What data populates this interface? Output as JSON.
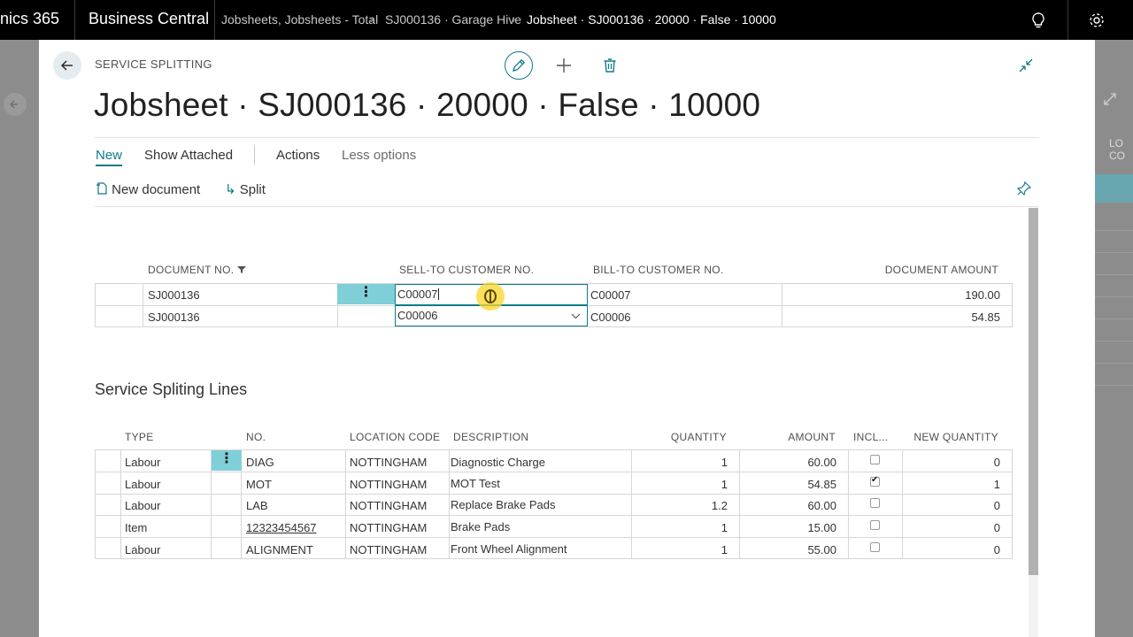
{
  "topbar": {
    "app_short": "nics 365",
    "product": "Business Central",
    "breadcrumbs": [
      "Jobsheets, Jobsheets - Total",
      "SJ000136 · Garage Hive",
      "Jobsheet · SJ000136 · 20000 · False · 10000"
    ]
  },
  "background": {
    "side_label_1": "LO",
    "side_label_2": "CO"
  },
  "dialog": {
    "caption": "SERVICE SPLITTING",
    "title": "Jobsheet · SJ000136 · 20000 · False · 10000",
    "menu": {
      "new": "New",
      "show_attached": "Show Attached",
      "actions": "Actions",
      "less_options": "Less options"
    },
    "actions": {
      "new_document": "New document",
      "split": "Split"
    }
  },
  "documents": {
    "headers": {
      "document_no": "DOCUMENT NO.",
      "sell_to": "SELL-TO CUSTOMER NO.",
      "bill_to": "BILL-TO CUSTOMER NO.",
      "amount": "DOCUMENT AMOUNT"
    },
    "rows": [
      {
        "document_no": "SJ000136",
        "sell_to": "C00007",
        "bill_to": "C00007",
        "amount": "190.00"
      },
      {
        "document_no": "SJ000136",
        "sell_to": "C00006",
        "bill_to": "C00006",
        "amount": "54.85"
      }
    ]
  },
  "lines": {
    "section_title": "Service Spliting Lines",
    "headers": {
      "type": "TYPE",
      "no": "NO.",
      "location": "LOCATION CODE",
      "description": "DESCRIPTION",
      "quantity": "QUANTITY",
      "amount": "AMOUNT",
      "incl": "INCL...",
      "new_quantity": "NEW QUANTITY"
    },
    "rows": [
      {
        "type": "Labour",
        "no": "DIAG",
        "location": "NOTTINGHAM",
        "description": "Diagnostic Charge",
        "quantity": "1",
        "amount": "60.00",
        "incl": false,
        "new_quantity": "0"
      },
      {
        "type": "Labour",
        "no": "MOT",
        "location": "NOTTINGHAM",
        "description": "MOT Test",
        "quantity": "1",
        "amount": "54.85",
        "incl": true,
        "new_quantity": "1"
      },
      {
        "type": "Labour",
        "no": "LAB",
        "location": "NOTTINGHAM",
        "description": "Replace Brake Pads",
        "quantity": "1.2",
        "amount": "60.00",
        "incl": false,
        "new_quantity": "0"
      },
      {
        "type": "Item",
        "no": "12323454567",
        "location": "NOTTINGHAM",
        "description": "Brake Pads",
        "quantity": "1",
        "amount": "15.00",
        "incl": false,
        "new_quantity": "0"
      },
      {
        "type": "Labour",
        "no": "ALIGNMENT",
        "location": "NOTTINGHAM",
        "description": "Front Wheel Alignment",
        "quantity": "1",
        "amount": "55.00",
        "incl": false,
        "new_quantity": "0"
      }
    ]
  },
  "icons": {
    "back": "back-arrow-icon",
    "edit": "pencil-icon",
    "add": "plus-icon",
    "delete": "trash-icon",
    "collapse": "collapse-icon",
    "pin": "pin-icon",
    "lightbulb": "lightbulb-icon",
    "settings": "gear-icon",
    "filter": "filter-icon",
    "new_document": "new-document-icon",
    "split": "split-arrow-icon"
  },
  "colors": {
    "accent": "#0f7b8a",
    "selected_row": "#cde8ec",
    "row_menu": "#7fcfd8",
    "topbar": "#000000"
  }
}
